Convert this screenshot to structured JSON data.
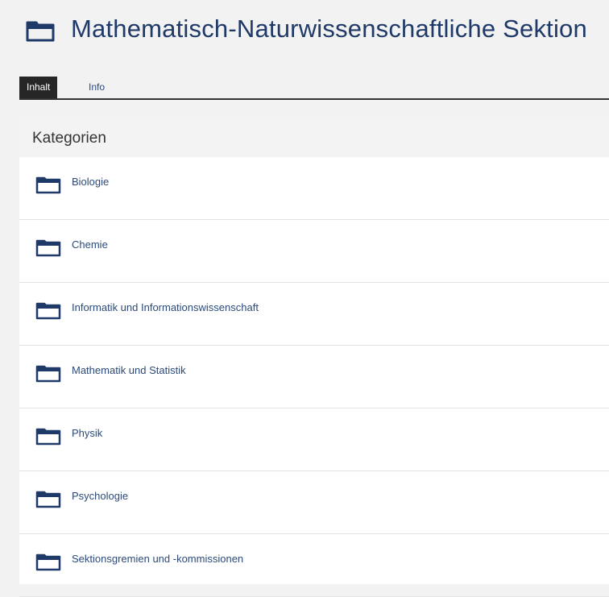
{
  "header": {
    "title": "Mathematisch-Naturwissenschaftliche Sektion"
  },
  "tabs": [
    {
      "label": "Inhalt",
      "active": true
    },
    {
      "label": "Info",
      "active": false
    }
  ],
  "section": {
    "title": "Kategorien"
  },
  "categories": [
    {
      "label": "Biologie"
    },
    {
      "label": "Chemie"
    },
    {
      "label": "Informatik und Informationswissenschaft"
    },
    {
      "label": "Mathematik und Statistik"
    },
    {
      "label": "Physik"
    },
    {
      "label": "Psychologie"
    },
    {
      "label": "Sektionsgremien und -kommissionen"
    }
  ],
  "colors": {
    "title": "#1f3a68",
    "link": "#2b4a7a",
    "tab_active_bg": "#262626",
    "icon": "#1f3a68"
  },
  "icons": {
    "title": "folder-icon",
    "category": "folder-icon"
  }
}
